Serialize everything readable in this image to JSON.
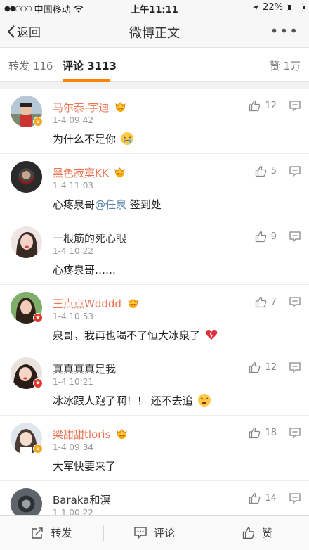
{
  "status_bar": {
    "carrier": "中国移动",
    "time": "上午11:11",
    "battery": "22%",
    "battery_level": 0.22
  },
  "nav": {
    "back_label": "返回",
    "title": "微博正文",
    "more_label": "•••"
  },
  "tabs": {
    "repost": "转发 116",
    "comments": "评论 3113",
    "likes": "赞 1万"
  },
  "comments": [
    {
      "name": "马尔泰-宇迪",
      "time": "1-4 09:42",
      "text": "为什么不是你",
      "likes": "12"
    },
    {
      "name": "黑色寂寞KK",
      "time": "1-4 11:03",
      "text_before": "心疼泉哥",
      "mention": "@任泉",
      "text_after": " 签到处",
      "likes": "5"
    },
    {
      "name": "一根筋的死心眼",
      "time": "1-4 10:22",
      "text": "心疼泉哥……",
      "likes": "9"
    },
    {
      "name": "王点点Wdddd",
      "time": "1-4 10:53",
      "text": "泉哥，我再也喝不了恒大冰泉了",
      "likes": "7"
    },
    {
      "name": "真真真真是我",
      "time": "1-4 10:21",
      "text": "冰冰跟人跑了啊！！ 还不去追",
      "likes": "12"
    },
    {
      "name": "梁甜甜tloris",
      "time": "1-4 09:34",
      "text": "大军快要来了",
      "likes": "18"
    },
    {
      "name": "Baraka和溟",
      "time": "1-1 00:22",
      "text": "",
      "likes": "14"
    }
  ],
  "toolbar": {
    "repost": "转发",
    "comment": "评论",
    "like": "赞"
  },
  "colors": {
    "accent": "#ff8200",
    "vip_name": "#eb7350",
    "mention": "#507daf"
  }
}
